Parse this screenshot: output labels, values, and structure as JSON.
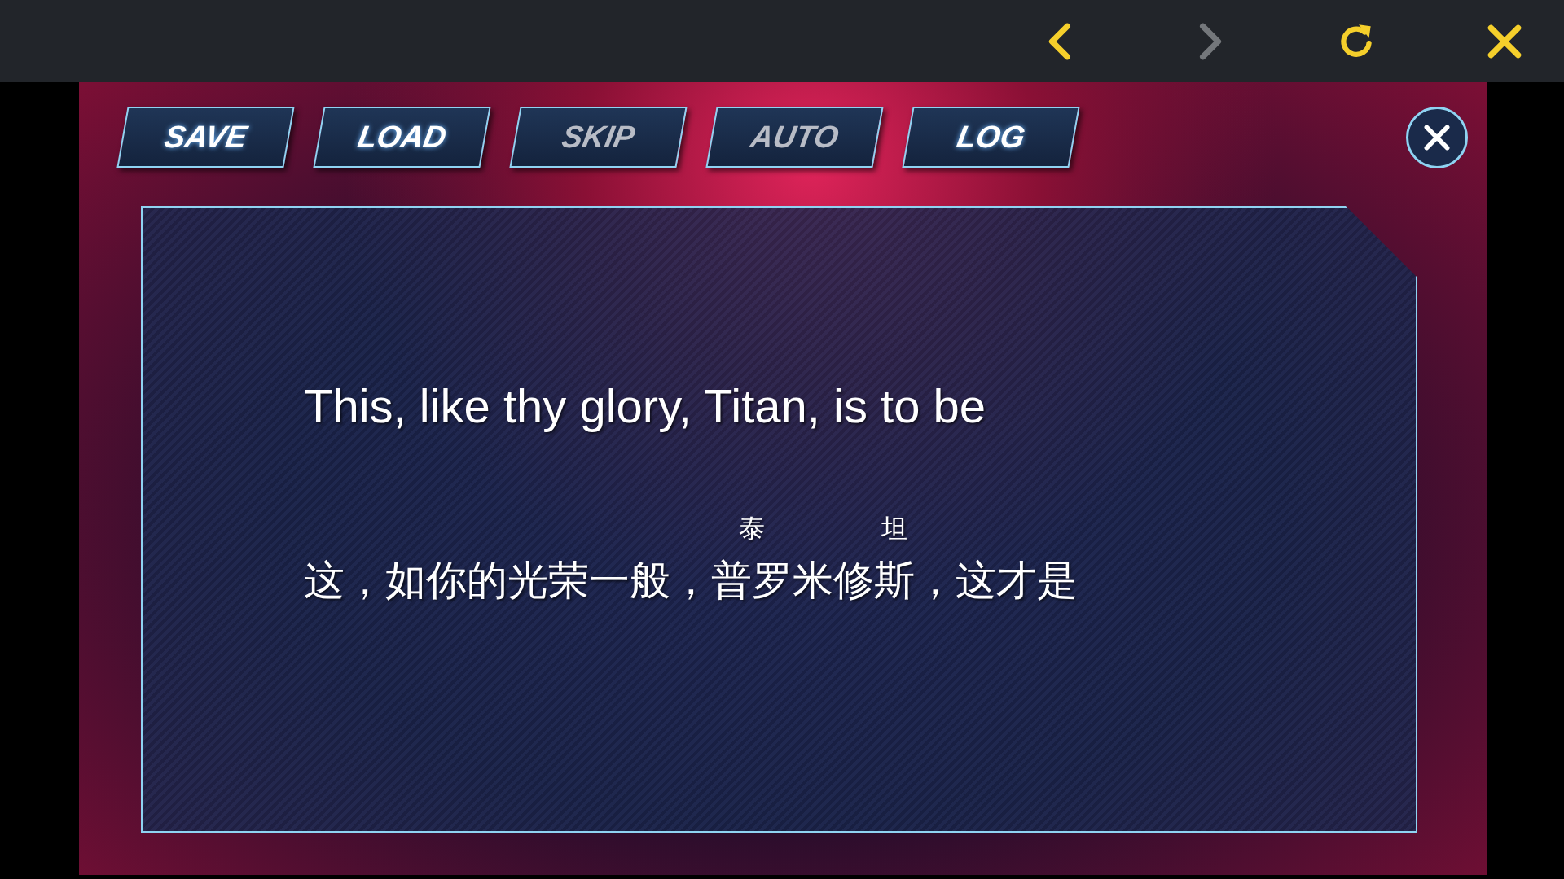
{
  "toolbar": {
    "buttons": [
      {
        "kind": "back",
        "disabled": false
      },
      {
        "kind": "forward",
        "disabled": true
      },
      {
        "kind": "reload",
        "disabled": false
      },
      {
        "kind": "close",
        "disabled": false
      }
    ]
  },
  "menu": {
    "buttons": [
      {
        "label": "SAVE",
        "disabled": false
      },
      {
        "label": "LOAD",
        "disabled": false
      },
      {
        "label": "SKIP",
        "disabled": true
      },
      {
        "label": "AUTO",
        "disabled": true
      },
      {
        "label": "LOG",
        "disabled": false
      }
    ]
  },
  "dialog": {
    "english": "This, like thy glory, Titan, is to be",
    "chinese": [
      {
        "text": "这，如你的光荣一般，"
      },
      {
        "text": "普罗",
        "ruby": "泰"
      },
      {
        "text": "米修"
      },
      {
        "text": "斯",
        "ruby": "坦"
      },
      {
        "text": "，这才是"
      }
    ]
  }
}
